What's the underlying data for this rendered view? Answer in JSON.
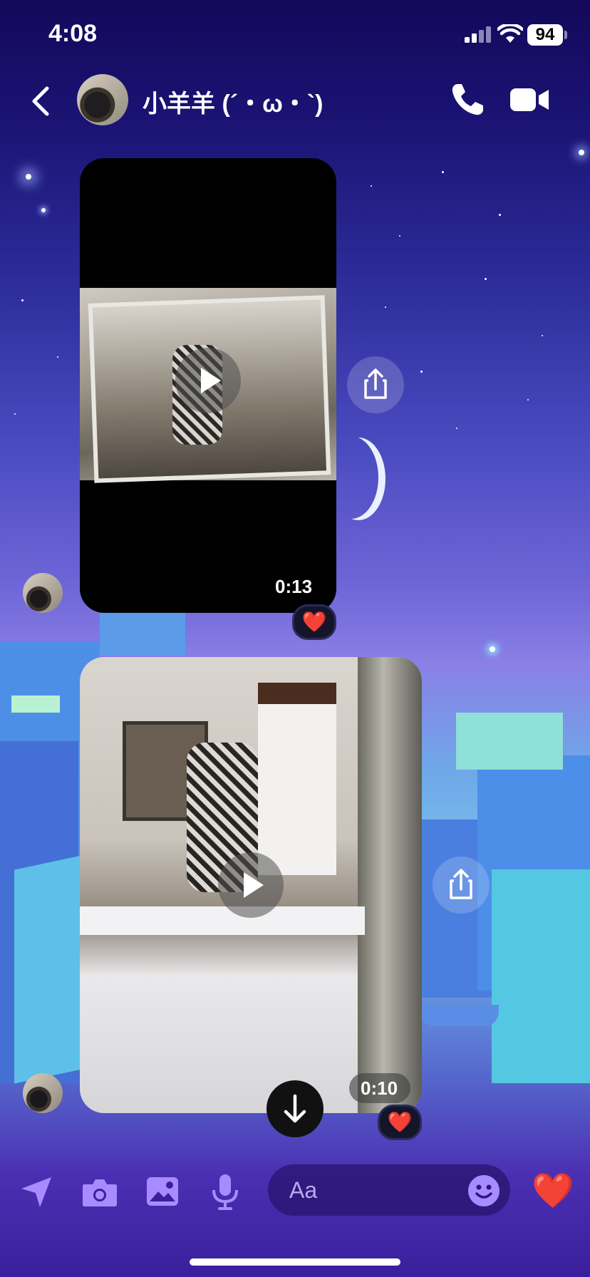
{
  "status_bar": {
    "time": "4:08",
    "battery": "94",
    "signal_icon": "cellular-signal-icon",
    "wifi_icon": "wifi-icon"
  },
  "header": {
    "contact_name": "小羊羊 (´・ω・`)",
    "back_icon": "chevron-left-icon",
    "call_icon": "phone-icon",
    "video_call_icon": "video-camera-icon"
  },
  "messages": [
    {
      "type": "video",
      "duration": "0:13",
      "reaction": "❤️",
      "share_icon": "share-icon",
      "play_icon": "play-icon"
    },
    {
      "type": "video",
      "duration": "0:10",
      "reaction": "❤️",
      "share_icon": "share-icon",
      "play_icon": "play-icon"
    }
  ],
  "scroll_down_icon": "arrow-down-icon",
  "composer": {
    "placeholder": "Aa",
    "location_icon": "location-arrow-icon",
    "camera_icon": "camera-icon",
    "gallery_icon": "photo-icon",
    "mic_icon": "microphone-icon",
    "emoji_icon": "smiley-icon",
    "like_reaction": "❤️"
  },
  "colors": {
    "accent": "#a88cff",
    "bubble_dark": "#000000",
    "heart": "#e8304a"
  }
}
